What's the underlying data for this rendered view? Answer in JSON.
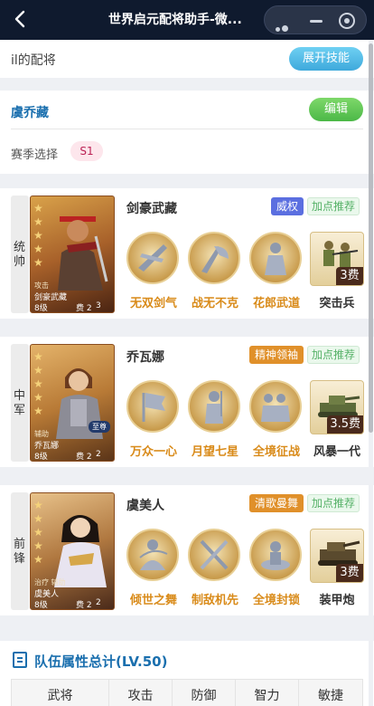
{
  "nav": {
    "back_icon": "chevron-left-icon",
    "title": "世界启元配将助手-微...",
    "more_icon": "more-dots-icon",
    "minimize_icon": "minimize-icon",
    "close_icon": "target-close-icon"
  },
  "header": {
    "owner_name": "il的配将",
    "expand_label": "展开技能"
  },
  "team": {
    "name": "虞乔藏",
    "edit_label": "编辑",
    "season_label": "赛季选择",
    "season_value": "S1"
  },
  "heroes": [
    {
      "position": "统帅",
      "name": "剑豪武藏",
      "card_role": "攻击",
      "card_name": "剑豪武藏",
      "level": "8级",
      "cost": "费 2",
      "extra": "3",
      "stars": 5,
      "trait": "威权",
      "trait_color": "#5b6fe0",
      "recommend": "加点推荐",
      "skills": [
        "无双剑气",
        "战无不克",
        "花郎武道"
      ],
      "troop": {
        "name": "突击兵",
        "fee": "3费"
      }
    },
    {
      "position": "中军",
      "name": "乔瓦娜",
      "card_role": "辅助",
      "card_name": "乔瓦娜",
      "level": "8级",
      "cost": "费 2",
      "extra": "2",
      "badge": "至尊",
      "stars": 5,
      "trait": "精神领袖",
      "trait_color": "#e0902a",
      "recommend": "加点推荐",
      "skills": [
        "万众一心",
        "月望七星",
        "全境征战"
      ],
      "troop": {
        "name": "风暴一代",
        "fee": "3.5费"
      }
    },
    {
      "position": "前锋",
      "name": "虞美人",
      "card_role": "治疗 辅助",
      "card_name": "虞美人",
      "level": "8级",
      "cost": "费 2",
      "extra": "2",
      "stars": 5,
      "trait": "清歌曼舞",
      "trait_color": "#e0902a",
      "recommend": "加点推荐",
      "skills": [
        "倾世之舞",
        "制敌机先",
        "全境封锁"
      ],
      "troop": {
        "name": "装甲炮",
        "fee": "3费"
      }
    }
  ],
  "summary": {
    "title": "队伍属性总计(LV.50)",
    "columns": [
      "武将",
      "攻击",
      "防御",
      "智力",
      "敏捷"
    ]
  },
  "colors": {
    "nav_bg": "#0f1a2e",
    "accent_blue": "#1a6fae",
    "skill_label": "#d98b1a",
    "recommend_green": "#55b167"
  }
}
